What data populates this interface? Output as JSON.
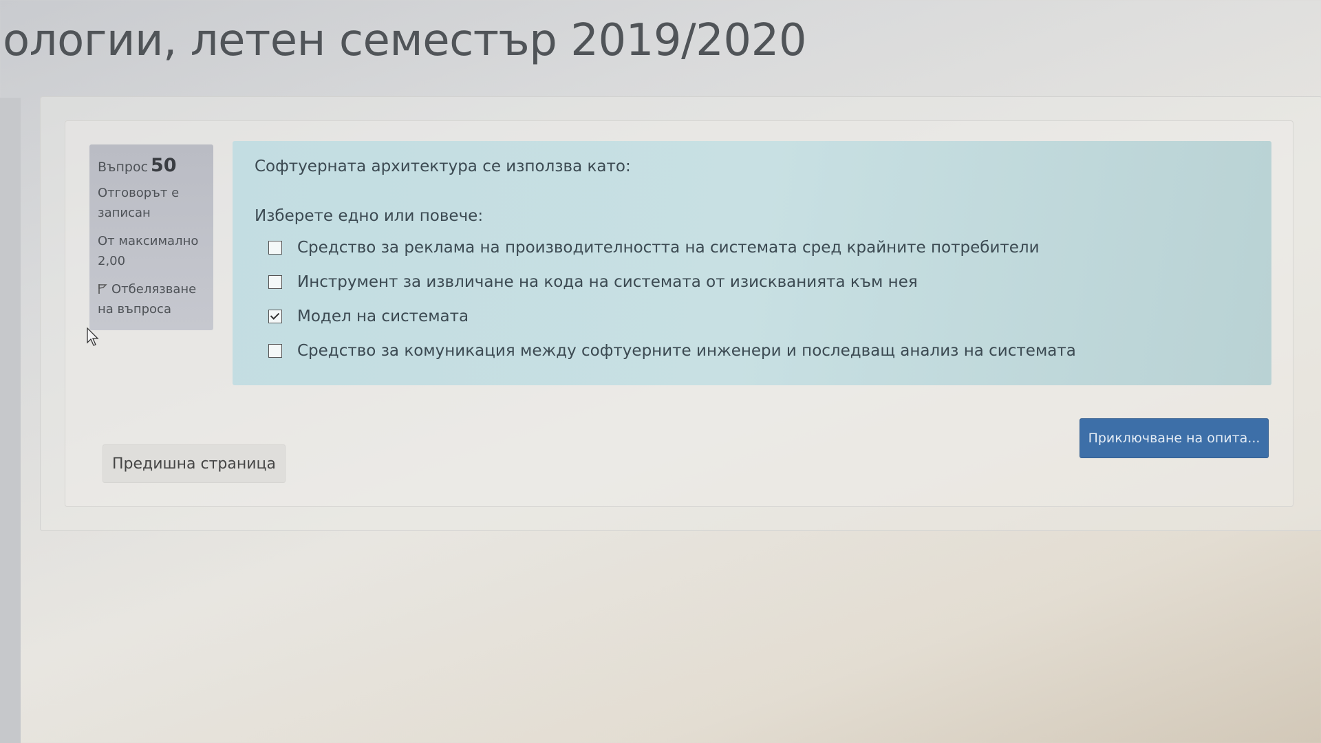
{
  "header": {
    "title": "ологии, летен семестър 2019/2020"
  },
  "question_info": {
    "label": "Въпрос",
    "number": "50",
    "state": "Отговорът е записан",
    "max_grade": "От максимално 2,00",
    "flag_label": "Отбелязване на въпроса"
  },
  "question": {
    "text": "Софтуерната архитектура се използва като:",
    "prompt": "Изберете едно или повече:",
    "answers": [
      {
        "label": "Средство за реклама на производителността на системата сред крайните потребители",
        "checked": false
      },
      {
        "label": "Инструмент за извличане на кода на системата от изискванията към нея",
        "checked": false
      },
      {
        "label": "Модел на системата",
        "checked": true
      },
      {
        "label": "Средство за комуникация между софтуерните инженери и последващ анализ на системата",
        "checked": false
      }
    ]
  },
  "navigation": {
    "prev_label": "Предишна страница",
    "finish_label": "Приключване на опита..."
  },
  "colors": {
    "accent": "#3d6fa8",
    "info_box": "#babcc4",
    "content_box": "#c3dde2"
  },
  "icons": [
    "flag-icon",
    "cursor-icon",
    "checkbox-icon"
  ]
}
